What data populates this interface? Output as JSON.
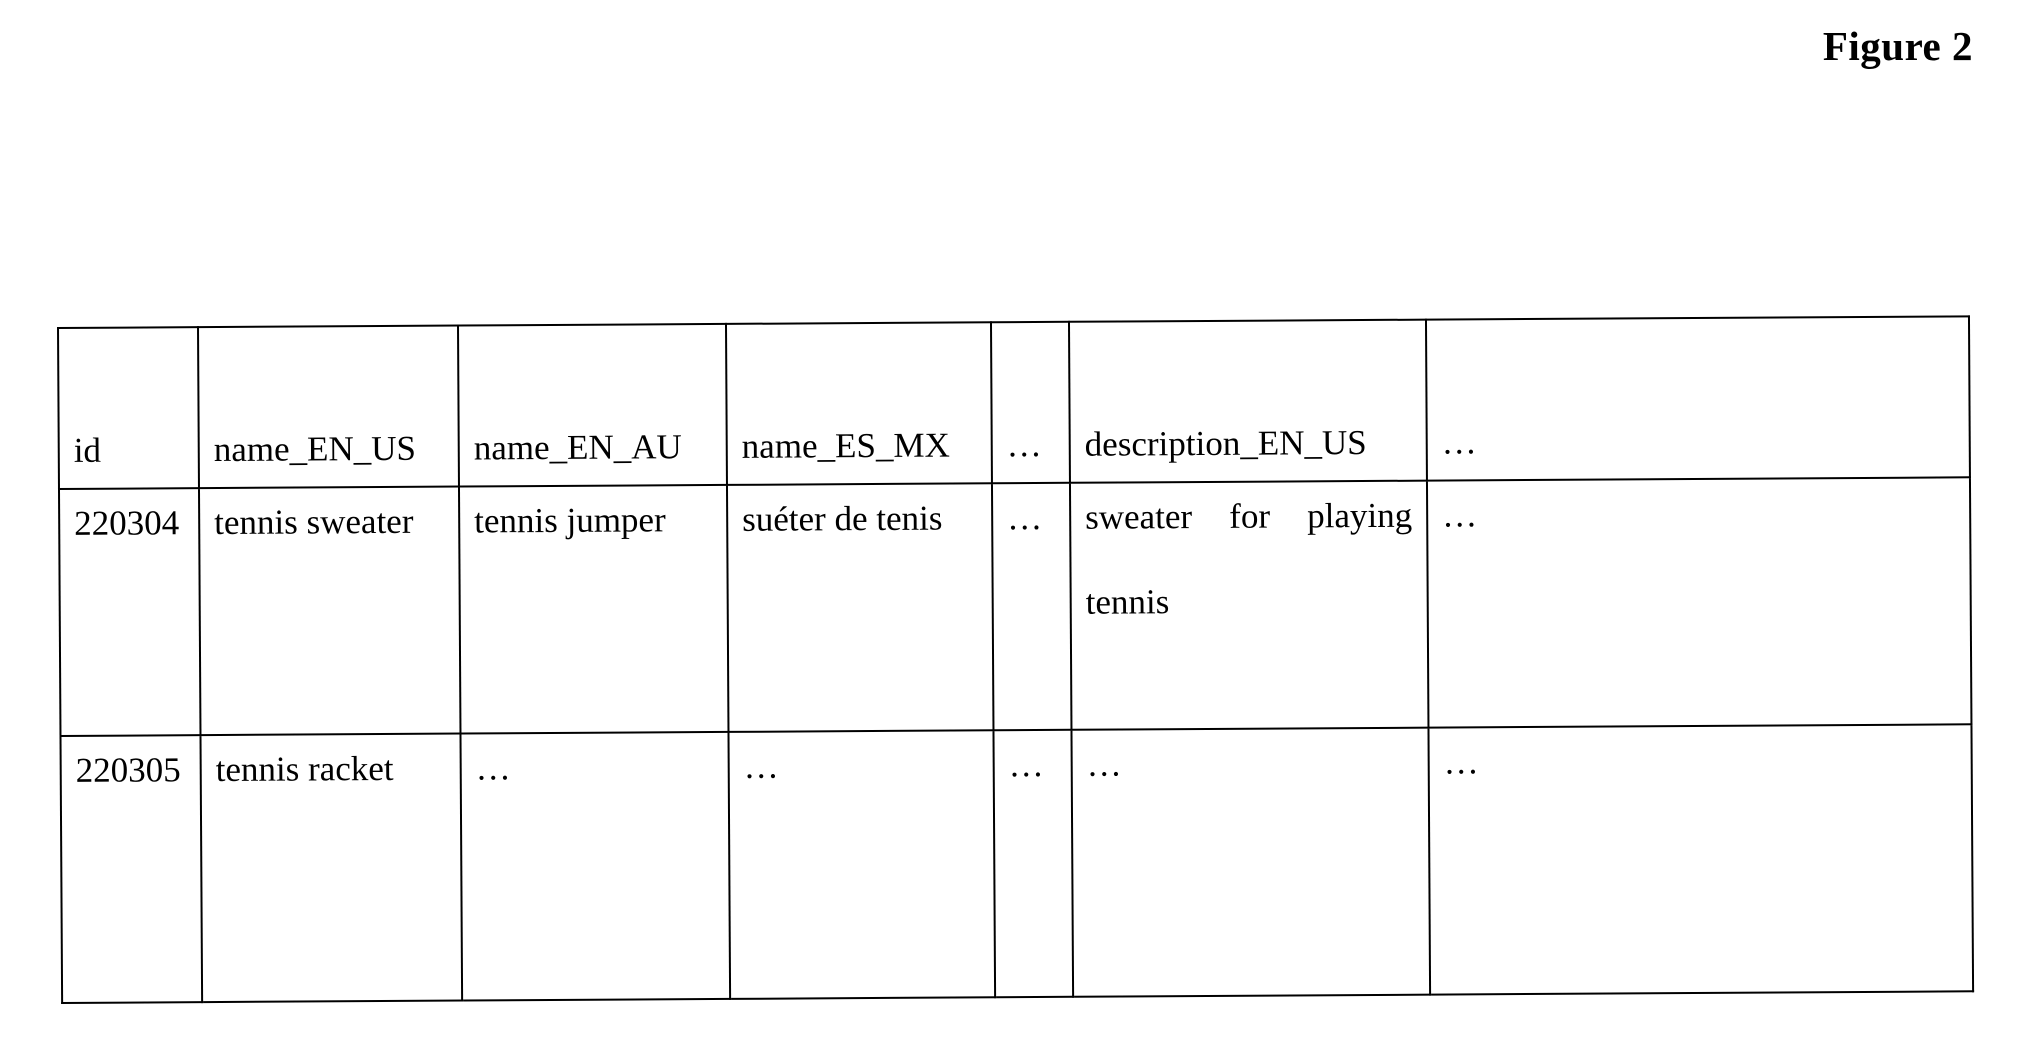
{
  "figure": {
    "caption": "Figure 2"
  },
  "table": {
    "columns": [
      {
        "key": "id",
        "header": "id"
      },
      {
        "key": "name_en_us",
        "header": "name_EN_US"
      },
      {
        "key": "name_en_au",
        "header": "name_EN_AU"
      },
      {
        "key": "name_es_mx",
        "header": "name_ES_MX"
      },
      {
        "key": "more_names",
        "header": "…"
      },
      {
        "key": "description_en_us",
        "header": "description_EN_US"
      },
      {
        "key": "more_descriptions",
        "header": "…"
      }
    ],
    "rows": [
      {
        "id": "220304",
        "name_en_us": "tennis sweater",
        "name_en_au": "tennis jumper",
        "name_es_mx": "suéter de tenis",
        "more_names": "…",
        "description_en_us_line1": "sweater for playing",
        "description_en_us_line2": "tennis",
        "more_descriptions": "…"
      },
      {
        "id": "220305",
        "name_en_us": "tennis racket",
        "name_en_au": "…",
        "name_es_mx": "…",
        "more_names": "…",
        "description_en_us_line1": "…",
        "description_en_us_line2": "",
        "more_descriptions": "…"
      }
    ]
  },
  "colors": {
    "ink": "#000000",
    "paper": "#ffffff"
  }
}
